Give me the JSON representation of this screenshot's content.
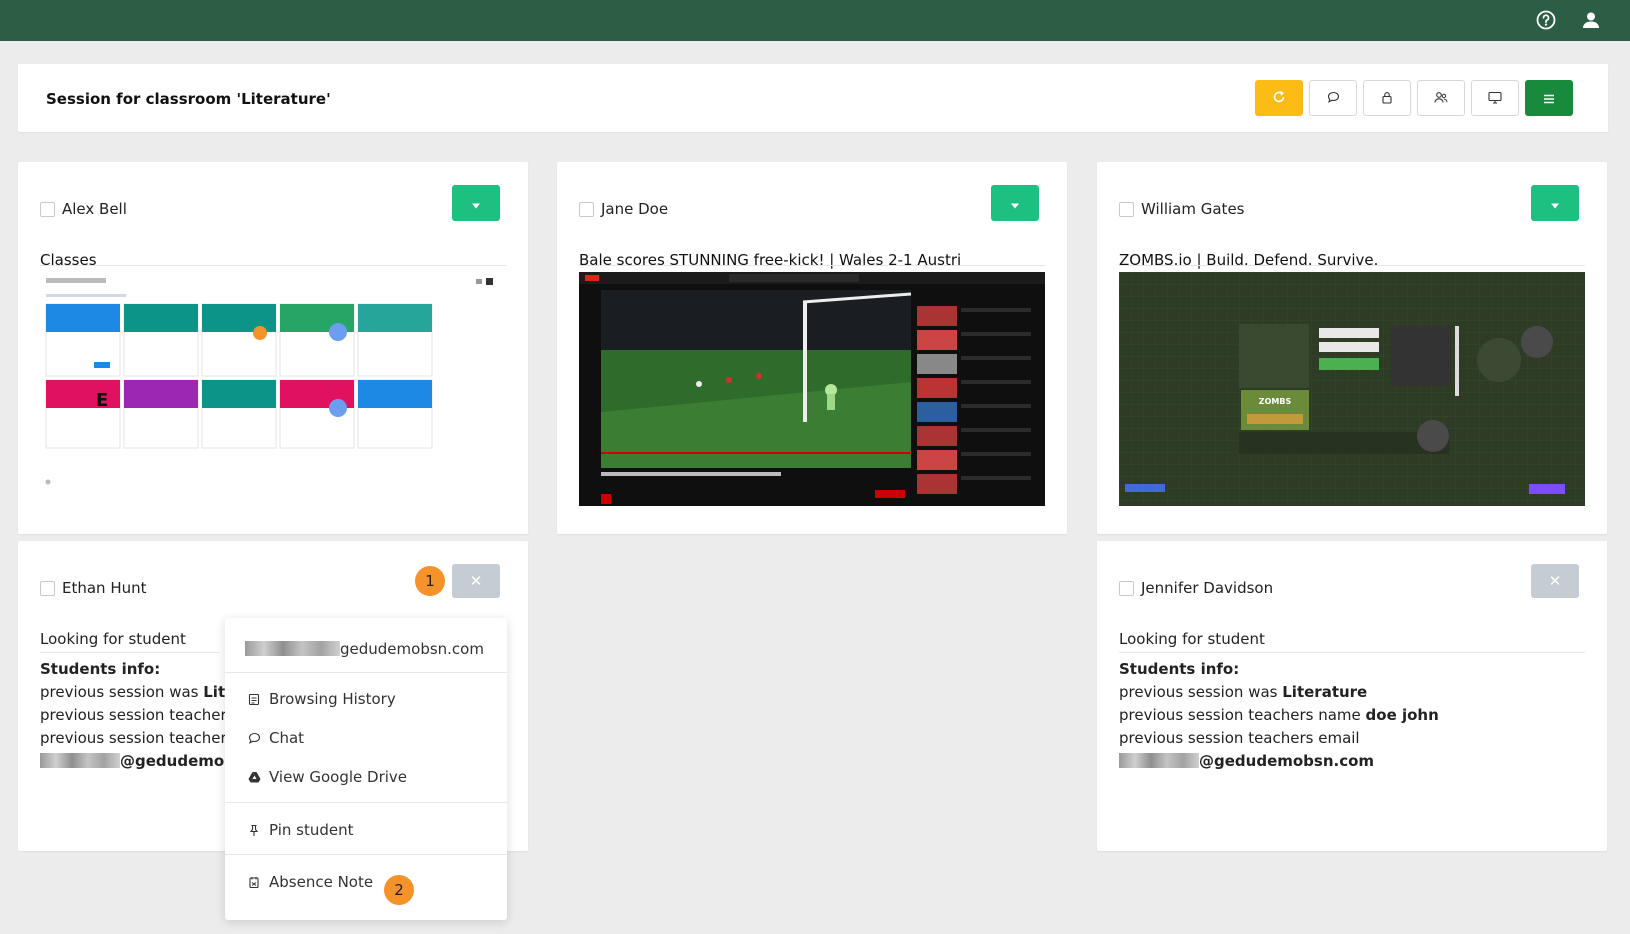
{
  "topbar": {
    "bg": "#2c5e45",
    "icons": [
      "help-icon",
      "user-icon"
    ]
  },
  "session": {
    "title": "Session for classroom 'Literature'",
    "toolbar": [
      {
        "icon": "refresh-icon",
        "color": "#fbbd15"
      },
      {
        "icon": "chat-icon"
      },
      {
        "icon": "lock-icon"
      },
      {
        "icon": "users-icon"
      },
      {
        "icon": "monitor-icon"
      },
      {
        "icon": "menu-icon",
        "color": "#178a3c"
      }
    ]
  },
  "students": [
    {
      "name": "Alex Bell",
      "tab_title": "Classes"
    },
    {
      "name": "Jane Doe",
      "tab_title": "Bale scores STUNNING free-kick! | Wales 2-1 Austri"
    },
    {
      "name": "William Gates",
      "tab_title": "ZOMBS.io | Build. Defend. Survive."
    },
    {
      "name": "Ethan Hunt",
      "status": "Looking for student",
      "info_heading": "Students info:",
      "info": {
        "prev_session_prefix": "previous session was ",
        "prev_session_value": "Lite",
        "teacher_name_prefix": "previous session teacher",
        "teacher_email_prefix": "previous session teacher",
        "email_domain": "@gedudemobsı"
      }
    },
    {
      "name": "Jennifer Davidson",
      "status": "Looking for student",
      "info_heading": "Students info:",
      "info": {
        "prev_session_prefix": "previous session was ",
        "prev_session_value": "Literature",
        "teacher_name_prefix": "previous session teachers name ",
        "teacher_name_value": "doe john",
        "teacher_email_prefix": "previous session teachers email",
        "email_domain": "@gedudemobsn.com"
      }
    }
  ],
  "dropdown_menu": {
    "email_suffix": "gedudemobsn.com",
    "items": [
      {
        "label": "Browsing History",
        "icon": "history-icon"
      },
      {
        "label": "Chat",
        "icon": "chat-icon"
      },
      {
        "label": "View Google Drive",
        "icon": "google-drive-icon"
      },
      {
        "label": "Pin student",
        "icon": "pin-icon"
      },
      {
        "label": "Absence Note",
        "icon": "absence-note-icon"
      }
    ]
  },
  "callouts": [
    "1",
    "2"
  ],
  "colors": {
    "accent_green": "#1ec081",
    "badge_orange": "#f5922a",
    "disabled_grey": "#c6ccd3"
  }
}
